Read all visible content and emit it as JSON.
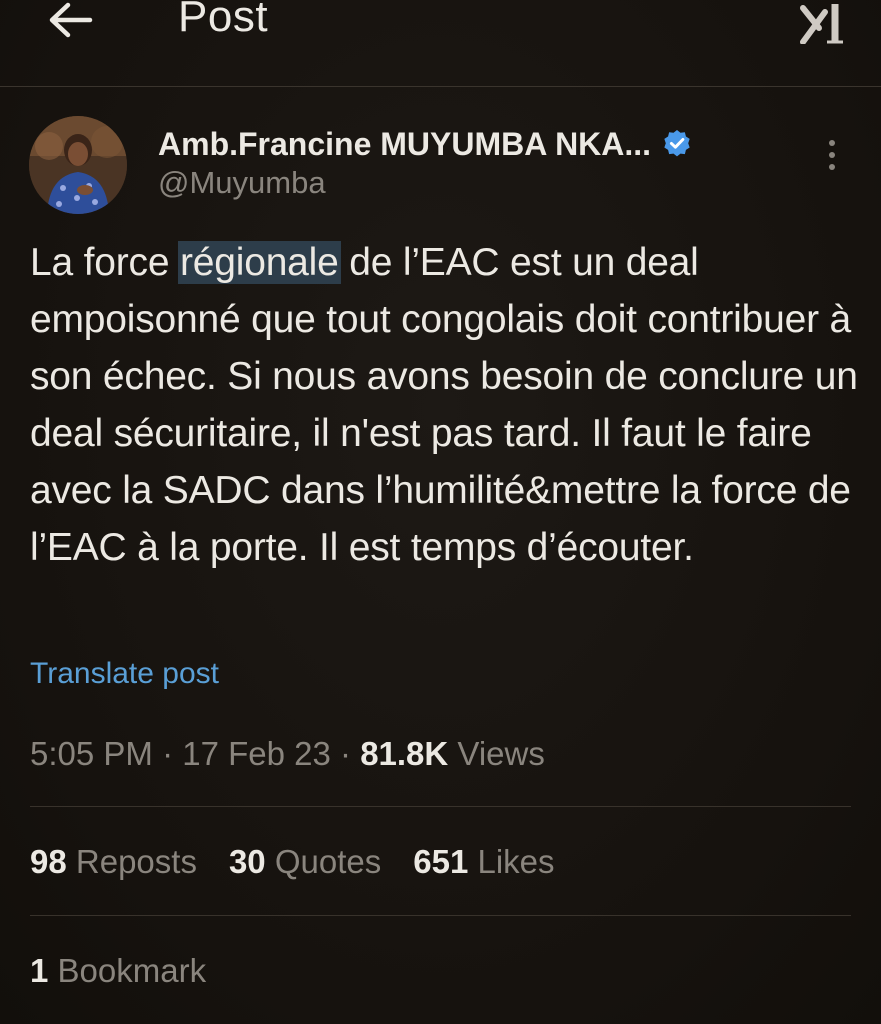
{
  "header": {
    "title": "Post",
    "back_icon": "arrow-left-icon",
    "grok_icon": "grok-icon"
  },
  "author": {
    "name": "Amb.Francine MUYUMBA NKA...",
    "handle": "@Muyumba",
    "verified": true,
    "verified_color": "#4a99e9"
  },
  "post": {
    "text_before": "La force ",
    "highlighted": "régionale",
    "text_after": " de l’EAC est un deal empoisonné que tout congolais doit contribuer à son échec. Si nous avons besoin de conclure un deal sécuritaire, il n'est pas tard. Il faut le faire avec la SADC dans l’humilité&mettre la force de l’EAC à la porte. Il est temps d’écouter.",
    "translate_label": "Translate post"
  },
  "meta": {
    "time": "5:05 PM",
    "sep1": " · ",
    "date": "17 Feb 23",
    "sep2": " · ",
    "views_count": "81.8K",
    "views_label": " Views"
  },
  "stats": {
    "reposts_count": "98",
    "reposts_label": " Reposts",
    "quotes_count": "30",
    "quotes_label": " Quotes",
    "likes_count": "651",
    "likes_label": " Likes",
    "bookmarks_count": "1",
    "bookmarks_label": " Bookmark"
  },
  "colors": {
    "background": "#17130f",
    "text": "#ece9e3",
    "muted": "#8a857e",
    "link": "#5a9fd6",
    "highlight": "#2d3d4a"
  }
}
